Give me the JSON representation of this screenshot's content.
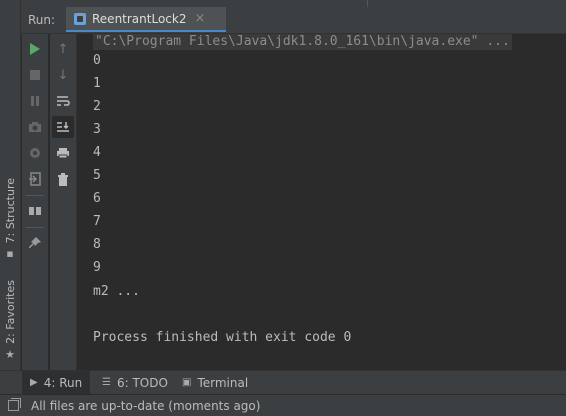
{
  "side_tabs": {
    "structure": "7: Structure",
    "favorites": "2: Favorites"
  },
  "header": {
    "run_label": "Run:",
    "tab_title": "ReentrantLock2",
    "tab_close": "×"
  },
  "console": {
    "command": "\"C:\\Program Files\\Java\\jdk1.8.0_161\\bin\\java.exe\" ...",
    "output_lines": [
      "0",
      "1",
      "2",
      "3",
      "4",
      "5",
      "6",
      "7",
      "8",
      "9",
      "m2 ..."
    ],
    "exit_message": "Process finished with exit code 0"
  },
  "bottom_tabs": {
    "run": "4: Run",
    "todo": "6: TODO",
    "terminal": "Terminal"
  },
  "status": {
    "text": "All files are up-to-date (moments ago)"
  },
  "colors": {
    "accent": "#4a88c7",
    "run_green": "#59a869",
    "background": "#2b2b2b",
    "panel": "#3c3f41"
  }
}
